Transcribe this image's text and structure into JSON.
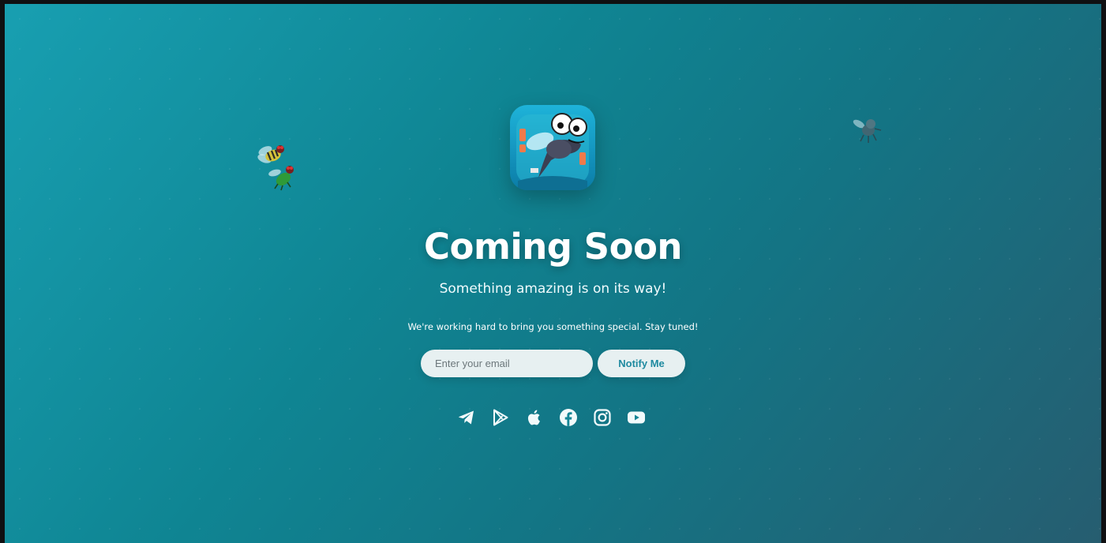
{
  "hero": {
    "title": "Coming Soon",
    "subtitle": "Something amazing is on its way!",
    "description": "We're working hard to bring you something special. Stay tuned!"
  },
  "signup": {
    "email_placeholder": "Enter your email",
    "email_value": "",
    "button_label": "Notify Me"
  },
  "socials": [
    {
      "icon": "telegram-icon"
    },
    {
      "icon": "google-play-icon"
    },
    {
      "icon": "apple-icon"
    },
    {
      "icon": "facebook-icon"
    },
    {
      "icon": "instagram-icon"
    },
    {
      "icon": "youtube-icon"
    }
  ],
  "decor": {
    "app_icon": "fly-app-icon",
    "flies": [
      "bee-fly-icon",
      "green-fly-icon",
      "gray-fly-icon"
    ]
  },
  "colors": {
    "background_start": "#189fb1",
    "background_end": "#265d70",
    "button_text": "#1f8aa0",
    "input_bg": "#e7f0f1"
  }
}
